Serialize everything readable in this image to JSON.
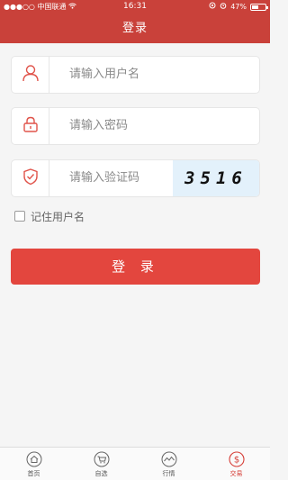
{
  "status_bar": {
    "carrier": "中国联通",
    "time": "16:31",
    "battery": "47%",
    "battery_level": 0.47
  },
  "header": {
    "title": "登录"
  },
  "form": {
    "username": {
      "placeholder": "请输入用户名",
      "icon": "user-icon"
    },
    "password": {
      "placeholder": "请输入密码",
      "icon": "lock-icon"
    },
    "captcha": {
      "placeholder": "请输入验证码",
      "icon": "shield-check-icon",
      "code": "3516",
      "code_bg": "#e3f1fb"
    },
    "remember_label": "记住用户名",
    "remember_checked": false,
    "login_button": "登 录"
  },
  "tabs": [
    {
      "label": "首页",
      "icon": "home-icon",
      "active": false
    },
    {
      "label": "自选",
      "icon": "cart-icon",
      "active": false
    },
    {
      "label": "行情",
      "icon": "chart-icon",
      "active": false
    },
    {
      "label": "交易",
      "icon": "trade-icon",
      "active": true
    }
  ],
  "colors": {
    "accent": "#c9413a",
    "button": "#e3463e",
    "icon": "#e0534a"
  }
}
